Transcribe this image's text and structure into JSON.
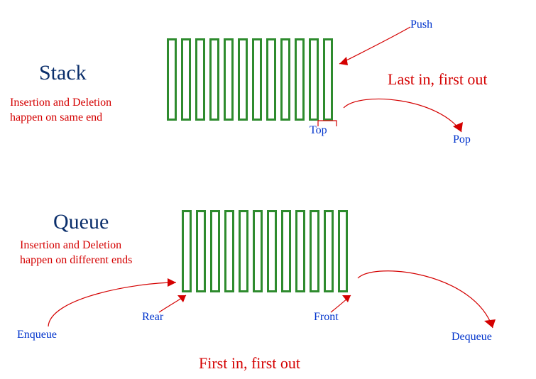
{
  "stack": {
    "title": "Stack",
    "caption": "Insertion and Deletion\nhappen on same end",
    "principle": "Last in, first out",
    "push_label": "Push",
    "pop_label": "Pop",
    "top_label": "Top"
  },
  "queue": {
    "title": "Queue",
    "caption": "Insertion and Deletion\nhappen on different ends",
    "principle": "First in, first out",
    "enqueue_label": "Enqueue",
    "dequeue_label": "Dequeue",
    "rear_label": "Rear",
    "front_label": "Front"
  },
  "colors": {
    "bar_border": "#2e8b2e",
    "title": "#0a2e6b",
    "caption": "#d40000",
    "label": "#0033cc"
  },
  "bar_count": 12
}
